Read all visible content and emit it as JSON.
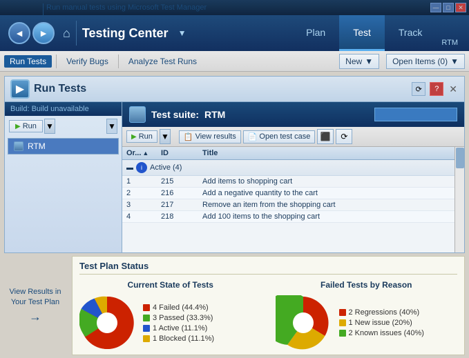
{
  "titlebar": {
    "buttons": [
      "minimize",
      "maximize",
      "close"
    ]
  },
  "navbar": {
    "title": "Testing Center",
    "tabs": [
      {
        "label": "Plan",
        "active": false
      },
      {
        "label": "Test",
        "active": true
      },
      {
        "label": "Track",
        "active": false
      }
    ],
    "rtm_label": "RTM",
    "dropdown_arrow": "▼"
  },
  "toolbar": {
    "items": [
      {
        "label": "Run Tests",
        "active": true
      },
      {
        "label": "Verify Bugs",
        "active": false
      },
      {
        "label": "Analyze Test Runs",
        "active": false
      }
    ],
    "new_label": "New",
    "open_items_label": "Open Items (0)",
    "dropdown_arrow": "▼"
  },
  "panel": {
    "title": "Run Tests",
    "build_label": "Build: Build unavailable",
    "suite_label": "Test suite:",
    "suite_name": "RTM",
    "run_button": "Run",
    "view_results_button": "View results",
    "open_test_case_button": "Open test case",
    "sidebar_item": "RTM"
  },
  "table": {
    "headers": [
      "Or...   ▲",
      "ID",
      "Title"
    ],
    "group_label": "Active (4)",
    "rows": [
      {
        "order": "1",
        "id": "215",
        "title": "Add items to shopping cart"
      },
      {
        "order": "2",
        "id": "216",
        "title": "Add a negative quantity to the cart"
      },
      {
        "order": "3",
        "id": "217",
        "title": "Remove an item from the shopping cart"
      },
      {
        "order": "4",
        "id": "218",
        "title": "Add 100 items to the shopping cart"
      }
    ]
  },
  "bottom": {
    "section_title": "Test Plan Status",
    "current_state_title": "Current State of Tests",
    "failed_tests_title": "Failed Tests by Reason",
    "current_state_legend": [
      {
        "color": "#cc2200",
        "label": "4 Failed (44.4%)"
      },
      {
        "color": "#44aa22",
        "label": "3 Passed (33.3%)"
      },
      {
        "color": "#2255cc",
        "label": "1 Active (11.1%)"
      },
      {
        "color": "#ddaa00",
        "label": "1 Blocked (11.1%)"
      }
    ],
    "failed_reason_legend": [
      {
        "color": "#cc2200",
        "label": "2 Regressions (40%)"
      },
      {
        "color": "#ddaa00",
        "label": "1 New issue (20%)"
      },
      {
        "color": "#44aa22",
        "label": "2 Known issues (40%)"
      }
    ],
    "current_state_slices": [
      {
        "pct": 44.4,
        "color": "#cc2200"
      },
      {
        "pct": 33.3,
        "color": "#44aa22"
      },
      {
        "pct": 11.1,
        "color": "#2255cc"
      },
      {
        "pct": 11.1,
        "color": "#ddaa00"
      }
    ],
    "failed_reason_slices": [
      {
        "pct": 40,
        "color": "#cc2200"
      },
      {
        "pct": 20,
        "color": "#ddaa00"
      },
      {
        "pct": 40,
        "color": "#44aa22"
      }
    ]
  },
  "annotations": {
    "top": "Run manual tests using Microsoft Test Manager",
    "bottom_line1": "View Results in",
    "bottom_line2": "Your Test Plan"
  }
}
